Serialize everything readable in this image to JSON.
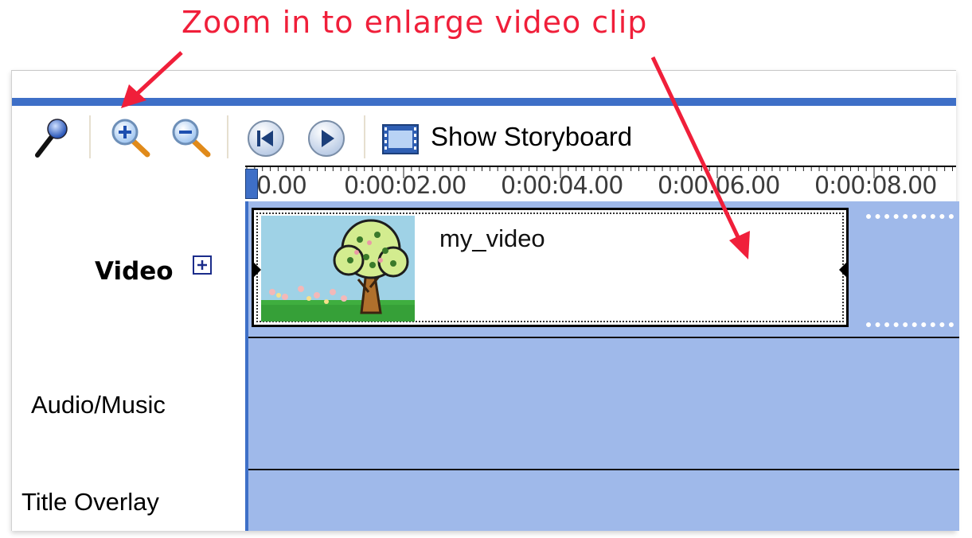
{
  "annotation": {
    "text": "Zoom in to enlarge video clip",
    "color": "#f01f3a"
  },
  "toolbar": {
    "narrate_icon": "microphone-icon",
    "zoom_in_icon": "zoom-in-icon",
    "zoom_out_icon": "zoom-out-icon",
    "rewind_icon": "rewind-icon",
    "play_icon": "play-icon",
    "storyboard_icon": "filmstrip-icon",
    "storyboard_label": "Show Storyboard"
  },
  "ruler": {
    "ticks": [
      "0.00",
      "0:00:02.00",
      "0:00:04.00",
      "0:00:06.00",
      "0:00:08.00"
    ]
  },
  "tracks": {
    "video_label": "Video",
    "expand_icon": "plus-box-icon",
    "audio_label": "Audio/Music",
    "title_label": "Title Overlay"
  },
  "clip": {
    "name": "my_video",
    "thumbnail": "tree-thumbnail"
  },
  "colors": {
    "accent_blue": "#3e6fc7",
    "track_blue": "#9fb9ea"
  }
}
